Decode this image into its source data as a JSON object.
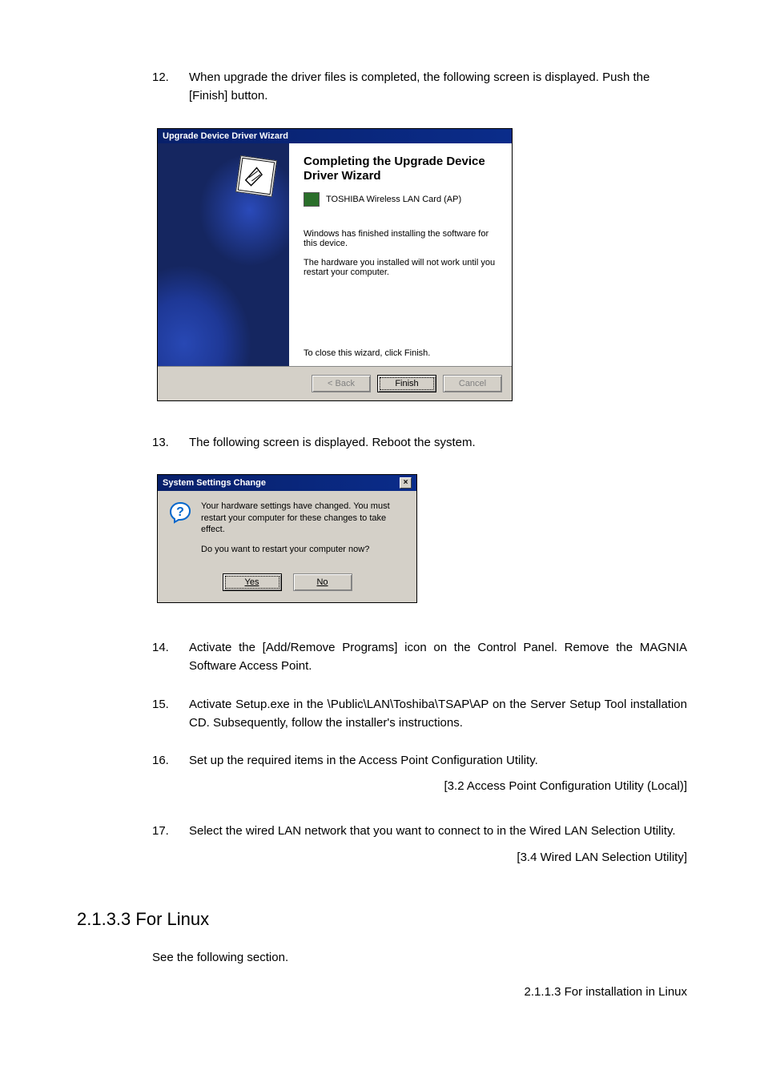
{
  "steps": {
    "s12": {
      "num": "12.",
      "text": "When upgrade the driver files is completed, the following screen is displayed. Push the [Finish] button."
    },
    "s13": {
      "num": "13.",
      "text": "The following screen is displayed.   Reboot the system."
    },
    "s14": {
      "num": "14.",
      "text": "Activate the [Add/Remove Programs] icon on the Control Panel. Remove the MAGNIA Software Access Point."
    },
    "s15": {
      "num": "15.",
      "text": "Activate Setup.exe in the \\Public\\LAN\\Toshiba\\TSAP\\AP on the Server Setup Tool installation CD. Subsequently, follow the installer's instructions."
    },
    "s16": {
      "num": "16.",
      "text": "Set up the required items in the Access Point Configuration Utility.",
      "ref": "[3.2 Access Point Configuration Utility (Local)]"
    },
    "s17": {
      "num": "17.",
      "text": "Select the wired LAN network that you want to connect to in the Wired LAN Selection Utility.",
      "ref": "[3.4 Wired LAN Selection Utility]"
    }
  },
  "wizard": {
    "title": "Upgrade Device Driver Wizard",
    "heading": "Completing the Upgrade Device Driver Wizard",
    "device": "TOSHIBA Wireless LAN Card (AP)",
    "line1": "Windows has finished installing the software for this device.",
    "line2": "The hardware you installed will not work until you restart your computer.",
    "close_hint": "To close this wizard, click Finish.",
    "buttons": {
      "back": "< Back",
      "finish": "Finish",
      "cancel": "Cancel"
    }
  },
  "msgbox": {
    "title": "System Settings Change",
    "line1": "Your hardware settings have changed. You must restart your computer for these changes to take effect.",
    "line2": "Do you want to restart your computer now?",
    "yes": "Yes",
    "no": "No"
  },
  "section": {
    "heading": "2.1.3.3  For Linux",
    "body": "See the following section.",
    "ref": "2.1.1.3 For installation in Linux"
  }
}
